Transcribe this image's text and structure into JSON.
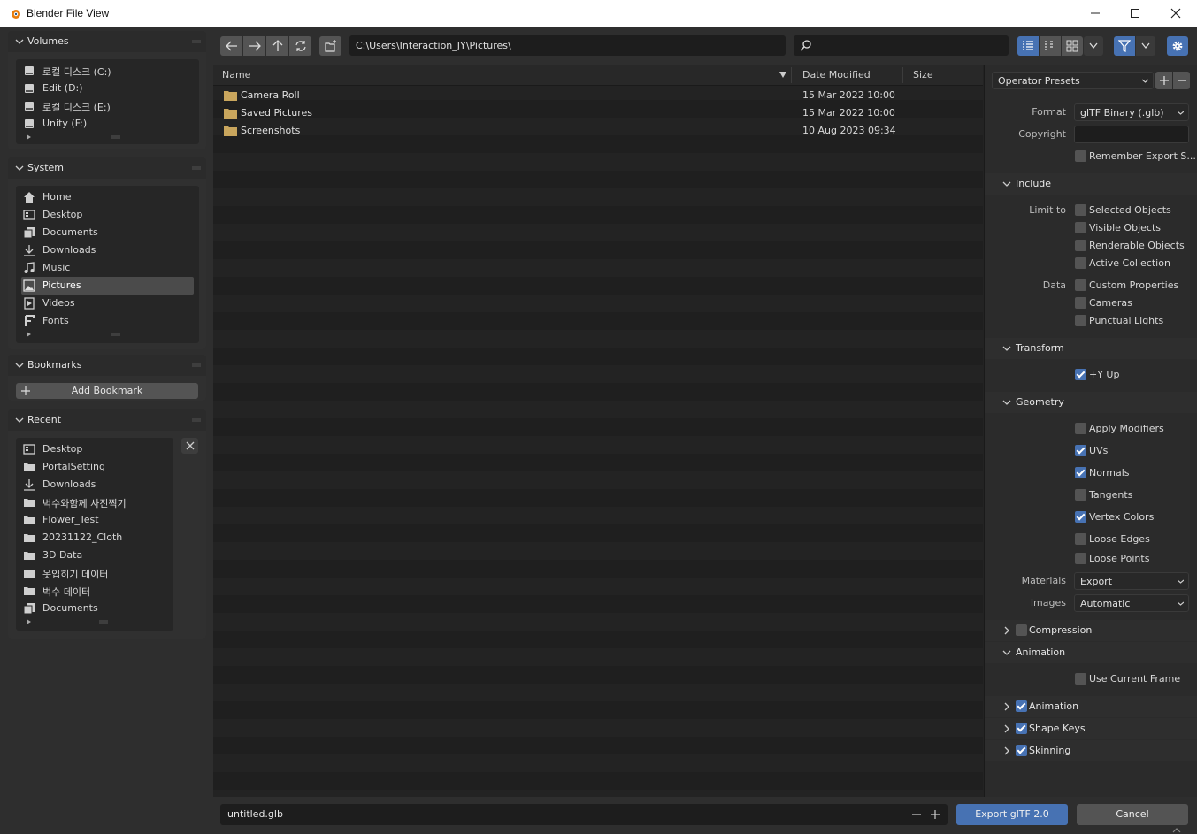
{
  "window": {
    "title": "Blender File View"
  },
  "sidebar": {
    "volumes": {
      "title": "Volumes",
      "items": [
        "로컬 디스크 (C:)",
        "Edit (D:)",
        "로컬 디스크 (E:)",
        "Unity (F:)"
      ]
    },
    "system": {
      "title": "System",
      "items": [
        "Home",
        "Desktop",
        "Documents",
        "Downloads",
        "Music",
        "Pictures",
        "Videos",
        "Fonts"
      ],
      "selected": "Pictures"
    },
    "bookmarks": {
      "title": "Bookmarks",
      "add_label": "Add Bookmark"
    },
    "recent": {
      "title": "Recent",
      "items": [
        "Desktop",
        "PortalSetting",
        "Downloads",
        "벅수와함께 사진찍기",
        "Flower_Test",
        "20231122_Cloth",
        "3D Data",
        "옷입히기 데이터",
        "벅수 데이터",
        "Documents"
      ]
    }
  },
  "toolbar": {
    "path": "C:\\Users\\Interaction_JY\\Pictures\\",
    "search_placeholder": ""
  },
  "filelist": {
    "columns": {
      "name": "Name",
      "date": "Date Modified",
      "size": "Size"
    },
    "rows": [
      {
        "name": "Camera Roll",
        "date": "15 Mar 2022 10:00"
      },
      {
        "name": "Saved Pictures",
        "date": "15 Mar 2022 10:00"
      },
      {
        "name": "Screenshots",
        "date": "10 Aug 2023 09:34"
      }
    ]
  },
  "options": {
    "presets": "Operator Presets",
    "format_label": "Format",
    "format_value": "glTF Binary (.glb)",
    "copyright_label": "Copyright",
    "copyright_value": "",
    "remember_label": "Remember Export S...",
    "include": {
      "title": "Include",
      "limit_label": "Limit to",
      "limit_items": [
        "Selected Objects",
        "Visible Objects",
        "Renderable Objects",
        "Active Collection"
      ],
      "data_label": "Data",
      "data_items": [
        "Custom Properties",
        "Cameras",
        "Punctual Lights"
      ]
    },
    "transform": {
      "title": "Transform",
      "yup": "+Y Up"
    },
    "geometry": {
      "title": "Geometry",
      "items": [
        "Apply Modifiers",
        "UVs",
        "Normals",
        "Tangents",
        "Vertex Colors",
        "Loose Edges",
        "Loose Points"
      ],
      "materials_label": "Materials",
      "materials_value": "Export",
      "images_label": "Images",
      "images_value": "Automatic"
    },
    "compression": "Compression",
    "animation": {
      "title": "Animation",
      "use_current_frame": "Use Current Frame",
      "subs": [
        "Animation",
        "Shape Keys",
        "Skinning"
      ]
    }
  },
  "bottom": {
    "filename": "untitled.glb",
    "export_label": "Export glTF 2.0",
    "cancel_label": "Cancel"
  },
  "colors": {
    "accent": "#4772b3",
    "folder": "#c9a65d"
  }
}
